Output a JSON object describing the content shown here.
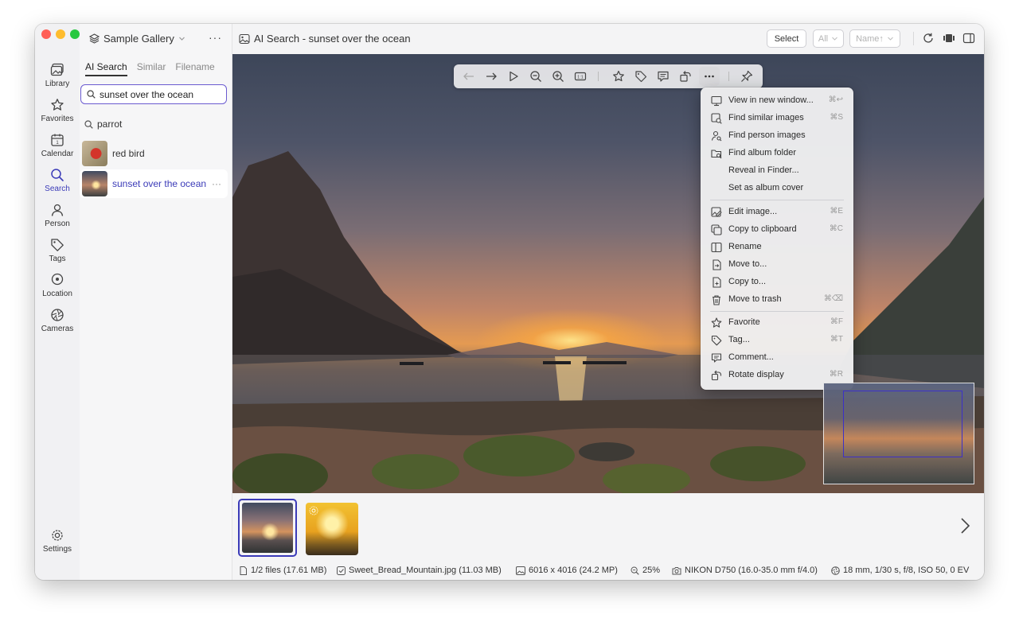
{
  "window": {
    "gallery_name": "Sample Gallery",
    "view_title": "AI Search - sunset over the ocean"
  },
  "rail": {
    "items": [
      {
        "label": "Library",
        "icon": "photo-library-icon"
      },
      {
        "label": "Favorites",
        "icon": "star-icon"
      },
      {
        "label": "Calendar",
        "icon": "calendar-icon"
      },
      {
        "label": "Search",
        "icon": "search-icon",
        "active": true
      },
      {
        "label": "Person",
        "icon": "person-icon"
      },
      {
        "label": "Tags",
        "icon": "tag-icon"
      },
      {
        "label": "Location",
        "icon": "location-pin-icon"
      },
      {
        "label": "Cameras",
        "icon": "aperture-icon"
      }
    ],
    "settings_label": "Settings"
  },
  "sidebar": {
    "tabs": [
      "AI Search",
      "Similar",
      "Filename"
    ],
    "active_tab": "AI Search",
    "search_value": "sunset over the ocean",
    "suggestion": "parrot",
    "results": [
      {
        "label": "red bird"
      },
      {
        "label": "sunset over the ocean",
        "active": true
      }
    ]
  },
  "toolbar": {
    "select_label": "Select",
    "filter_label": "All",
    "sort_label": "Name↑"
  },
  "context_menu": {
    "groups": [
      [
        {
          "label": "View in new window...",
          "shortcut": "⌘↩",
          "icon": "monitor-icon"
        },
        {
          "label": "Find similar images",
          "shortcut": "⌘S",
          "icon": "image-search-icon"
        },
        {
          "label": "Find person images",
          "shortcut": "",
          "icon": "person-search-icon"
        },
        {
          "label": "Find album folder",
          "shortcut": "",
          "icon": "folder-search-icon"
        },
        {
          "label": "Reveal in Finder...",
          "shortcut": "",
          "icon": ""
        },
        {
          "label": "Set as album cover",
          "shortcut": "",
          "icon": ""
        }
      ],
      [
        {
          "label": "Edit image...",
          "shortcut": "⌘E",
          "icon": "edit-image-icon"
        },
        {
          "label": "Copy to clipboard",
          "shortcut": "⌘C",
          "icon": "copy-icon"
        },
        {
          "label": "Rename",
          "shortcut": "",
          "icon": "rename-icon"
        },
        {
          "label": "Move to...",
          "shortcut": "",
          "icon": "move-file-icon"
        },
        {
          "label": "Copy to...",
          "shortcut": "",
          "icon": "copy-file-icon"
        },
        {
          "label": "Move to trash",
          "shortcut": "⌘⌫",
          "icon": "trash-icon"
        }
      ],
      [
        {
          "label": "Favorite",
          "shortcut": "⌘F",
          "icon": "star-icon"
        },
        {
          "label": "Tag...",
          "shortcut": "⌘T",
          "icon": "tag-icon"
        },
        {
          "label": "Comment...",
          "shortcut": "",
          "icon": "comment-icon"
        },
        {
          "label": "Rotate display",
          "shortcut": "⌘R",
          "icon": "rotate-icon"
        }
      ]
    ]
  },
  "status": {
    "files": "1/2 files (17.61 MB)",
    "filename": "Sweet_Bread_Mountain.jpg (11.03 MB)",
    "dimensions": "6016 x 4016 (24.2 MP)",
    "zoom": "25%",
    "camera": "NIKON D750 (16.0-35.0 mm f/4.0)",
    "exposure": "18 mm, 1/30 s, f/8, ISO 50, 0 EV"
  },
  "colors": {
    "accent": "#3b3bb8",
    "search_border": "#6a5ad0"
  }
}
